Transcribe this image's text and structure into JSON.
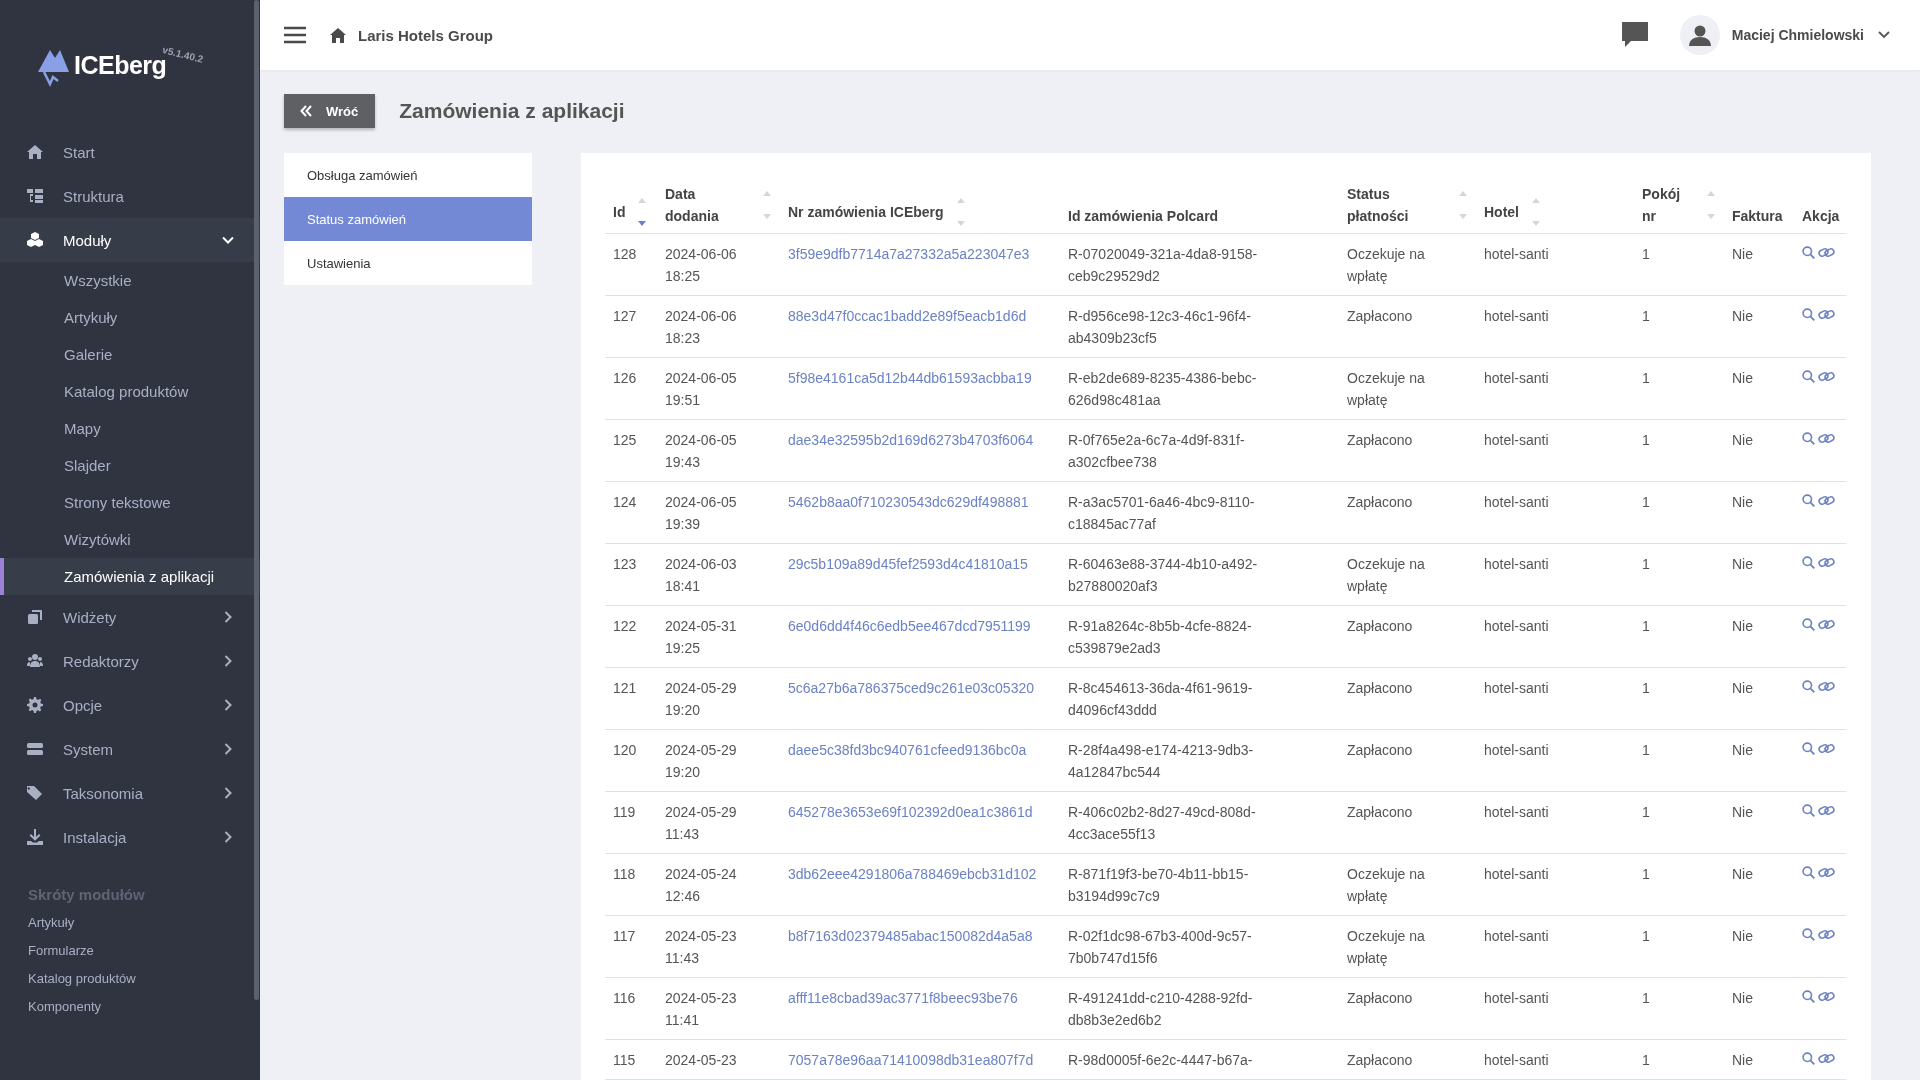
{
  "sidebar": {
    "logo": "ICEberg",
    "version": "v5.1.40.2",
    "items": [
      {
        "label": "Start"
      },
      {
        "label": "Struktura"
      },
      {
        "label": "Moduły",
        "expanded": true,
        "children": [
          {
            "label": "Wszystkie",
            "selected": false
          },
          {
            "label": "Artykuły",
            "selected": false
          },
          {
            "label": "Galerie",
            "selected": false
          },
          {
            "label": "Katalog produktów",
            "selected": false
          },
          {
            "label": "Mapy",
            "selected": false
          },
          {
            "label": "Slajder",
            "selected": false
          },
          {
            "label": "Strony tekstowe",
            "selected": false
          },
          {
            "label": "Wizytówki",
            "selected": false
          },
          {
            "label": "Zamówienia z aplikacji",
            "selected": true
          }
        ]
      },
      {
        "label": "Widżety",
        "expanded": false
      },
      {
        "label": "Redaktorzy",
        "expanded": false
      },
      {
        "label": "Opcje",
        "expanded": false
      },
      {
        "label": "System",
        "expanded": false
      },
      {
        "label": "Taksonomia",
        "expanded": false
      },
      {
        "label": "Instalacja",
        "expanded": false
      }
    ],
    "shortcuts": {
      "title": "Skróty modułów",
      "items": [
        "Artykuły",
        "Formularze",
        "Katalog produktów",
        "Komponenty"
      ]
    }
  },
  "header": {
    "company": "Laris Hotels Group",
    "user": "Maciej Chmielowski"
  },
  "page": {
    "back_button": "Wróć",
    "title": "Zamówienia z aplikacji"
  },
  "subnav": [
    {
      "label": "Obsługa zamówień",
      "selected": false
    },
    {
      "label": "Status zamówień",
      "selected": true
    },
    {
      "label": "Ustawienia",
      "selected": false
    }
  ],
  "table": {
    "columns": [
      {
        "label": "Id",
        "sortable": true,
        "sorted_desc": true
      },
      {
        "label": "Data dodania",
        "sortable": true,
        "sorted_desc": false
      },
      {
        "label": "Nr zamówienia ICEberg",
        "sortable": true,
        "sorted_desc": false
      },
      {
        "label": "Id zamówienia Polcard",
        "sortable": false
      },
      {
        "label": "Status płatności",
        "sortable": true,
        "sorted_desc": false
      },
      {
        "label": "Hotel",
        "sortable": true,
        "sorted_desc": false
      },
      {
        "label": "Pokój nr",
        "sortable": true,
        "sorted_desc": false
      },
      {
        "label": "Faktura",
        "sortable": false
      },
      {
        "label": "Akcja",
        "sortable": false
      }
    ],
    "rows": [
      {
        "id": "128",
        "date": "2024-06-06 18:25",
        "order_no": "3f59e9dfb7714a7a27332a5a223047e3",
        "polcard": "R-07020049-321a-4da8-9158-ceb9c29529d2",
        "status": "Oczekuje na wpłatę",
        "hotel": "hotel-santi",
        "room": "1",
        "invoice": "Nie"
      },
      {
        "id": "127",
        "date": "2024-06-06 18:23",
        "order_no": "88e3d47f0ccac1badd2e89f5eacb1d6d",
        "polcard": "R-d956ce98-12c3-46c1-96f4-ab4309b23cf5",
        "status": "Zapłacono",
        "hotel": "hotel-santi",
        "room": "1",
        "invoice": "Nie"
      },
      {
        "id": "126",
        "date": "2024-06-05 19:51",
        "order_no": "5f98e4161ca5d12b44db61593acbba19",
        "polcard": "R-eb2de689-8235-4386-bebc-626d98c481aa",
        "status": "Oczekuje na wpłatę",
        "hotel": "hotel-santi",
        "room": "1",
        "invoice": "Nie"
      },
      {
        "id": "125",
        "date": "2024-06-05 19:43",
        "order_no": "dae34e32595b2d169d6273b4703f6064",
        "polcard": "R-0f765e2a-6c7a-4d9f-831f-a302cfbee738",
        "status": "Zapłacono",
        "hotel": "hotel-santi",
        "room": "1",
        "invoice": "Nie"
      },
      {
        "id": "124",
        "date": "2024-06-05 19:39",
        "order_no": "5462b8aa0f710230543dc629df498881",
        "polcard": "R-a3ac5701-6a46-4bc9-8110-c18845ac77af",
        "status": "Zapłacono",
        "hotel": "hotel-santi",
        "room": "1",
        "invoice": "Nie"
      },
      {
        "id": "123",
        "date": "2024-06-03 18:41",
        "order_no": "29c5b109a89d45fef2593d4c41810a15",
        "polcard": "R-60463e88-3744-4b10-a492-b27880020af3",
        "status": "Oczekuje na wpłatę",
        "hotel": "hotel-santi",
        "room": "1",
        "invoice": "Nie"
      },
      {
        "id": "122",
        "date": "2024-05-31 19:25",
        "order_no": "6e0d6dd4f46c6edb5ee467dcd7951199",
        "polcard": "R-91a8264c-8b5b-4cfe-8824-c539879e2ad3",
        "status": "Zapłacono",
        "hotel": "hotel-santi",
        "room": "1",
        "invoice": "Nie"
      },
      {
        "id": "121",
        "date": "2024-05-29 19:20",
        "order_no": "5c6a27b6a786375ced9c261e03c05320",
        "polcard": "R-8c454613-36da-4f61-9619-d4096cf43ddd",
        "status": "Zapłacono",
        "hotel": "hotel-santi",
        "room": "1",
        "invoice": "Nie"
      },
      {
        "id": "120",
        "date": "2024-05-29 19:20",
        "order_no": "daee5c38fd3bc940761cfeed9136bc0a",
        "polcard": "R-28f4a498-e174-4213-9db3-4a12847bc544",
        "status": "Zapłacono",
        "hotel": "hotel-santi",
        "room": "1",
        "invoice": "Nie"
      },
      {
        "id": "119",
        "date": "2024-05-29 11:43",
        "order_no": "645278e3653e69f102392d0ea1c3861d",
        "polcard": "R-406c02b2-8d27-49cd-808d-4cc3ace55f13",
        "status": "Zapłacono",
        "hotel": "hotel-santi",
        "room": "1",
        "invoice": "Nie"
      },
      {
        "id": "118",
        "date": "2024-05-24 12:46",
        "order_no": "3db62eee4291806a788469ebcb31d102",
        "polcard": "R-871f19f3-be70-4b11-bb15-b3194d99c7c9",
        "status": "Oczekuje na wpłatę",
        "hotel": "hotel-santi",
        "room": "1",
        "invoice": "Nie"
      },
      {
        "id": "117",
        "date": "2024-05-23 11:43",
        "order_no": "b8f7163d02379485abac150082d4a5a8",
        "polcard": "R-02f1dc98-67b3-400d-9c57-7b0b747d15f6",
        "status": "Oczekuje na wpłatę",
        "hotel": "hotel-santi",
        "room": "1",
        "invoice": "Nie"
      },
      {
        "id": "116",
        "date": "2024-05-23 11:41",
        "order_no": "afff11e8cbad39ac3771f8beec93be76",
        "polcard": "R-491241dd-c210-4288-92fd-db8b3e2ed6b2",
        "status": "Zapłacono",
        "hotel": "hotel-santi",
        "room": "1",
        "invoice": "Nie"
      },
      {
        "id": "115",
        "date": "2024-05-23",
        "order_no": "7057a78e96aa71410098db31ea807f7d",
        "polcard": "R-98d0005f-6e2c-4447-b67a-",
        "status": "Zapłacono",
        "hotel": "hotel-santi",
        "room": "1",
        "invoice": "Nie"
      }
    ]
  }
}
